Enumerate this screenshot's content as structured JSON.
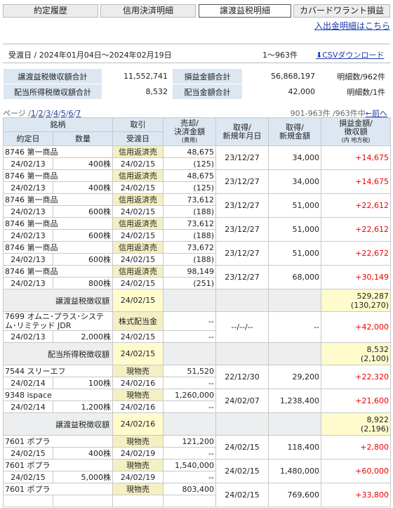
{
  "tabs": [
    "約定履歴",
    "信用決済明細",
    "譲渡益税明細",
    "カバードワラント損益"
  ],
  "deposit_link": "入出金明細はこちら",
  "period_label": "受渡日 / 2024年01月04日～2024年02月19日",
  "range_label": "1～963件",
  "csv_label": "CSVダウンロード",
  "summary": {
    "r1": [
      "譲渡益税徴収額合計",
      "11,552,741",
      "損益金額合計",
      "56,868,197",
      "明細数/962件"
    ],
    "r2": [
      "配当所得税徴収額合計",
      "8,532",
      "配当金額合計",
      "42,000",
      "明細数/1件"
    ]
  },
  "pager": {
    "prefix": "ページ /",
    "pages": [
      "1",
      "2",
      "3",
      "4",
      "5",
      "6",
      "7"
    ],
    "count": "901-963件 /963件中",
    "prev": "←前へ"
  },
  "headers": {
    "brand": "銘柄",
    "trade": "取引",
    "sell": "売却/\n決済金額",
    "sell_sub": "(費用)",
    "acq_date": "取得/\n新規年月日",
    "acq_amt": "取得/\n新規金額",
    "pl": "損益金額/\n徴収額",
    "pl_sub": "(内 地方税)",
    "contract_date": "約定日",
    "qty": "数量",
    "settle_date": "受渡日"
  },
  "rows": [
    {
      "type": "trade",
      "name": "8746 第一商品",
      "kind": "信用返済売",
      "amount": "48,675",
      "fee": "(125)",
      "acq_date": "23/12/27",
      "acq_amt": "34,000",
      "pl": "+14,675",
      "date": "24/02/13",
      "qty": "400株",
      "settle": "24/02/15"
    },
    {
      "type": "trade",
      "name": "8746 第一商品",
      "kind": "信用返済売",
      "amount": "48,675",
      "fee": "(125)",
      "acq_date": "23/12/27",
      "acq_amt": "34,000",
      "pl": "+14,675",
      "date": "24/02/13",
      "qty": "400株",
      "settle": "24/02/15"
    },
    {
      "type": "trade",
      "name": "8746 第一商品",
      "kind": "信用返済売",
      "amount": "73,612",
      "fee": "(188)",
      "acq_date": "23/12/27",
      "acq_amt": "51,000",
      "pl": "+22,612",
      "date": "24/02/13",
      "qty": "600株",
      "settle": "24/02/15"
    },
    {
      "type": "trade",
      "name": "8746 第一商品",
      "kind": "信用返済売",
      "amount": "73,612",
      "fee": "(188)",
      "acq_date": "23/12/27",
      "acq_amt": "51,000",
      "pl": "+22,612",
      "date": "24/02/13",
      "qty": "600株",
      "settle": "24/02/15"
    },
    {
      "type": "trade",
      "name": "8746 第一商品",
      "kind": "信用返済売",
      "amount": "73,672",
      "fee": "(188)",
      "acq_date": "23/12/27",
      "acq_amt": "51,000",
      "pl": "+22,672",
      "date": "24/02/13",
      "qty": "600株",
      "settle": "24/02/15"
    },
    {
      "type": "trade",
      "name": "8746 第一商品",
      "kind": "信用返済売",
      "amount": "98,149",
      "fee": "(251)",
      "acq_date": "23/12/27",
      "acq_amt": "68,000",
      "pl": "+30,149",
      "date": "24/02/13",
      "qty": "800株",
      "settle": "24/02/15"
    },
    {
      "type": "sum",
      "label": "譲渡益税徴収額",
      "settle": "24/02/15",
      "v1": "529,287",
      "v2": "(130,270)"
    },
    {
      "type": "trade",
      "name": "7699 オムニ･プラス･システム･リミテッド JDR",
      "kind": "株式配当金",
      "amount": "--",
      "fee": "--",
      "acq_date": "--/--/--",
      "acq_amt": "--",
      "pl": "+42,000",
      "date": "24/02/13",
      "qty": "2,000株",
      "settle": "24/02/15"
    },
    {
      "type": "sum",
      "label": "配当所得税徴収額",
      "settle": "24/02/15",
      "v1": "8,532",
      "v2": "(2,100)"
    },
    {
      "type": "trade",
      "name": "7544 スリーエフ",
      "kind": "現物売",
      "amount": "51,520",
      "fee": "--",
      "acq_date": "22/12/30",
      "acq_amt": "29,200",
      "pl": "+22,320",
      "date": "24/02/14",
      "qty": "100株",
      "settle": "24/02/16"
    },
    {
      "type": "trade",
      "name": "9348 ispace",
      "kind": "現物売",
      "amount": "1,260,000",
      "fee": "--",
      "acq_date": "24/02/07",
      "acq_amt": "1,238,400",
      "pl": "+21,600",
      "date": "24/02/14",
      "qty": "1,200株",
      "settle": "24/02/16"
    },
    {
      "type": "sum",
      "label": "譲渡益税徴収額",
      "settle": "24/02/16",
      "v1": "8,922",
      "v2": "(2,196)"
    },
    {
      "type": "trade",
      "name": "7601 ポプラ",
      "kind": "現物売",
      "amount": "121,200",
      "fee": "--",
      "acq_date": "24/02/15",
      "acq_amt": "118,400",
      "pl": "+2,800",
      "date": "24/02/15",
      "qty": "400株",
      "settle": "24/02/19"
    },
    {
      "type": "trade",
      "name": "7601 ポプラ",
      "kind": "現物売",
      "amount": "1,540,000",
      "fee": "--",
      "acq_date": "24/02/15",
      "acq_amt": "1,480,000",
      "pl": "+60,000",
      "date": "24/02/15",
      "qty": "5,000株",
      "settle": "24/02/19"
    },
    {
      "type": "trade",
      "name": "7601 ポプラ",
      "kind": "現物売",
      "amount": "803,400",
      "fee": "",
      "acq_date": "24/02/15",
      "acq_amt": "769,600",
      "pl": "+33,800",
      "date": "",
      "qty": "",
      "settle": ""
    }
  ]
}
